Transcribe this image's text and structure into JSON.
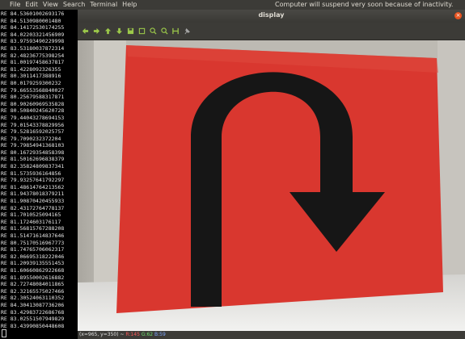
{
  "sysbar": {
    "menus": [
      "File",
      "Edit",
      "View",
      "Search",
      "Terminal",
      "Help"
    ],
    "notice": "Computer will suspend very soon because of inactivity."
  },
  "terminal": {
    "lines": [
      "RE 84.53601002693176",
      "RE 84.5130980001480",
      "RE 84.14172530174255",
      "RE 84.02203321456909",
      "RE 83.97593490229998",
      "RE 83.53180037872314",
      "RE 82.48236775398254",
      "RE 81.00197458637817",
      "RE 81.4228092326355",
      "RE 80.3011417388916",
      "RE 80.0179259300232",
      "RE 79.66553568840027",
      "RE 80.25679588317871",
      "RE 80.90260969535828",
      "RE 80.50840245620728",
      "RE 79.44043278694153",
      "RE 79.01543378829956",
      "RE 79.52816592025757",
      "RE 79.7090232372204",
      "RE 79.79854941368103",
      "RE 80.16729354858398",
      "RE 81.50162696838379",
      "RE 82.35824809837341",
      "RE 81.5735936164856",
      "RE 79.93257641792297",
      "RE 81.48614764213562",
      "RE 81.94378018379211",
      "RE 81.90870420455933",
      "RE 82.43172764778137",
      "RE 81.7010525094165",
      "RE 81.1724603176117",
      "RE 81.56815767288208",
      "RE 81.51471614837646",
      "RE 80.75170516967773",
      "RE 81.74765706062317",
      "RE 82.06695318222046",
      "RE 81.20939135551453",
      "RE 81.60660862922668",
      "RE 81.89550002616882",
      "RE 82.72748084011865",
      "RE 82.32165575027466",
      "RE 82.30524063110352",
      "RE 84.30413087736206",
      "RE 83.42983722686768",
      "RE 83.02551507949829",
      "RE 83.43990850448608"
    ]
  },
  "window": {
    "title": "display",
    "toolbar_icons": [
      "arrow-left-icon",
      "arrow-right-icon",
      "arrow-up-icon",
      "arrow-down-icon",
      "save-icon",
      "select-region-icon",
      "zoom-in-icon",
      "zoom-out-icon",
      "properties-icon",
      "pin-icon"
    ],
    "status": {
      "coords": "(x=965, y=350) ~",
      "r": "R:145",
      "g": "G:62",
      "b": "B:59"
    }
  },
  "colors": {
    "sign_red": "#d9372f",
    "arrow_black": "#161616"
  }
}
